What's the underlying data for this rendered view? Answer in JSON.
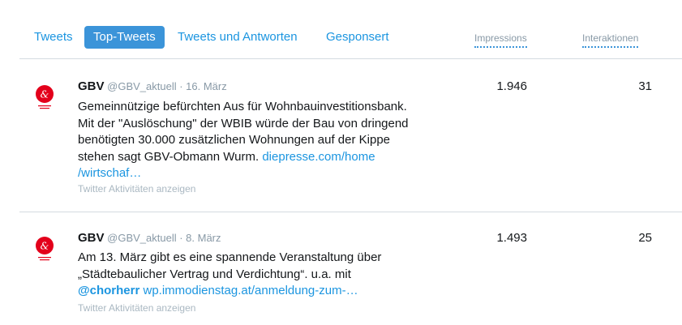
{
  "tabs": [
    {
      "label": "Tweets"
    },
    {
      "label": "Top-Tweets",
      "active": true
    },
    {
      "label": "Tweets und Antworten"
    },
    {
      "label": "Gesponsert"
    }
  ],
  "columns": {
    "impressions": "Impressions",
    "interactions": "Interaktionen"
  },
  "tweets": [
    {
      "name": "GBV",
      "handle": "@GBV_aktuell",
      "sep": " · ",
      "date": "16. März",
      "lines": [
        "Gemeinnützige befürchten Aus für Wohnbauinvestitionsbank.",
        "Mit der \"Auslöschung\" der WBIB würde der Bau von dringend",
        "benötigten 30.000 zusätzlichen Wohnungen auf der Kippe"
      ],
      "line4_text": "stehen sagt GBV-Obmann Wurm. ",
      "line4_link": "diepresse.com/home",
      "line5_link": "/wirtschaf…",
      "activity": "Twitter Aktivitäten anzeigen",
      "impressions": "1.946",
      "interactions": "31"
    },
    {
      "name": "GBV",
      "handle": "@GBV_aktuell",
      "sep": " · ",
      "date": "8. März",
      "lines": [
        "Am 13. März gibt es eine spannende Veranstaltung über",
        "„Städtebaulicher Vertrag und Verdichtung“. u.a. mit"
      ],
      "mention": "@chorherr",
      "line3_link": " wp.immodienstag.at/anmeldung-zum-…",
      "activity": "Twitter Aktivitäten anzeigen",
      "impressions": "1.493",
      "interactions": "25"
    }
  ],
  "colors": {
    "accent": "#1b95e0",
    "logo_red": "#e3001b"
  },
  "icons": {
    "avatar": "gbv-logo-icon"
  }
}
